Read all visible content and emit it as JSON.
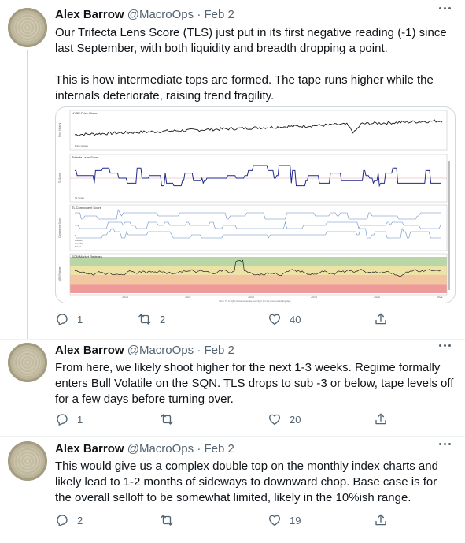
{
  "tweets": [
    {
      "author_name": "Alex Barrow",
      "handle": "@MacroOps",
      "separator": "·",
      "date": "Feb 2",
      "paragraphs": [
        "Our Trifecta Lens Score (TLS) just put in its first negative reading (-1) since last September, with both liquidity and breadth dropping a point.",
        "This is how intermediate tops are formed. The tape runs higher while the internals deteriorate, raising trend fragility."
      ],
      "replies": "1",
      "retweets": "2",
      "likes": "40"
    },
    {
      "author_name": "Alex Barrow",
      "handle": "@MacroOps",
      "separator": "·",
      "date": "Feb 2",
      "paragraphs": [
        "From here, we likely shoot higher for the next 1-3 weeks. Regime formally enters Bull Volatile on the SQN. TLS drops to sub -3 or below, tape levels off for a few days before turning over."
      ],
      "replies": "1",
      "retweets": "",
      "likes": "20"
    },
    {
      "author_name": "Alex Barrow",
      "handle": "@MacroOps",
      "separator": "·",
      "date": "Feb 2",
      "paragraphs": [
        "This would give us a complex double top on the monthly index charts and likely lead to 1-2 months of sideways to downward chop. Base case is for the overall selloff to be somewhat limited, likely in the 10%ish range."
      ],
      "replies": "2",
      "retweets": "",
      "likes": "19"
    }
  ],
  "chart": {
    "panels": [
      {
        "title": "NYSE Price History",
        "ylabel": "Price History",
        "legend": [
          "Price History"
        ]
      },
      {
        "title": "Trifecta Lens Score",
        "ylabel": "TL Score",
        "legend": [
          "TL Score"
        ]
      },
      {
        "title": "TL Component Score",
        "ylabel": "Component Score",
        "legend": [
          "Breadth",
          "Liquidity",
          "Trend"
        ]
      },
      {
        "title": "SQN Market Regimes",
        "ylabel": "SQN Regime",
        "legend": []
      }
    ],
    "x_ticks": [
      "2016",
      "2017",
      "2018",
      "2019",
      "2020",
      "2021"
    ],
    "footer_note": "Note: TL & SQN indicators update overnight (for the previous trading day)",
    "colors": {
      "price": "#1a1a1a",
      "tls": "#1f2a8c",
      "component": "#4a78b5",
      "zone_green": "#b9d6a6",
      "zone_yellow": "#eee3a6",
      "zone_orange": "#f2c6a0",
      "zone_red": "#ef9a9a"
    }
  },
  "icons": {
    "reply": "reply-icon",
    "retweet": "retweet-icon",
    "like": "heart-icon",
    "share": "share-icon",
    "more": "more-icon"
  }
}
